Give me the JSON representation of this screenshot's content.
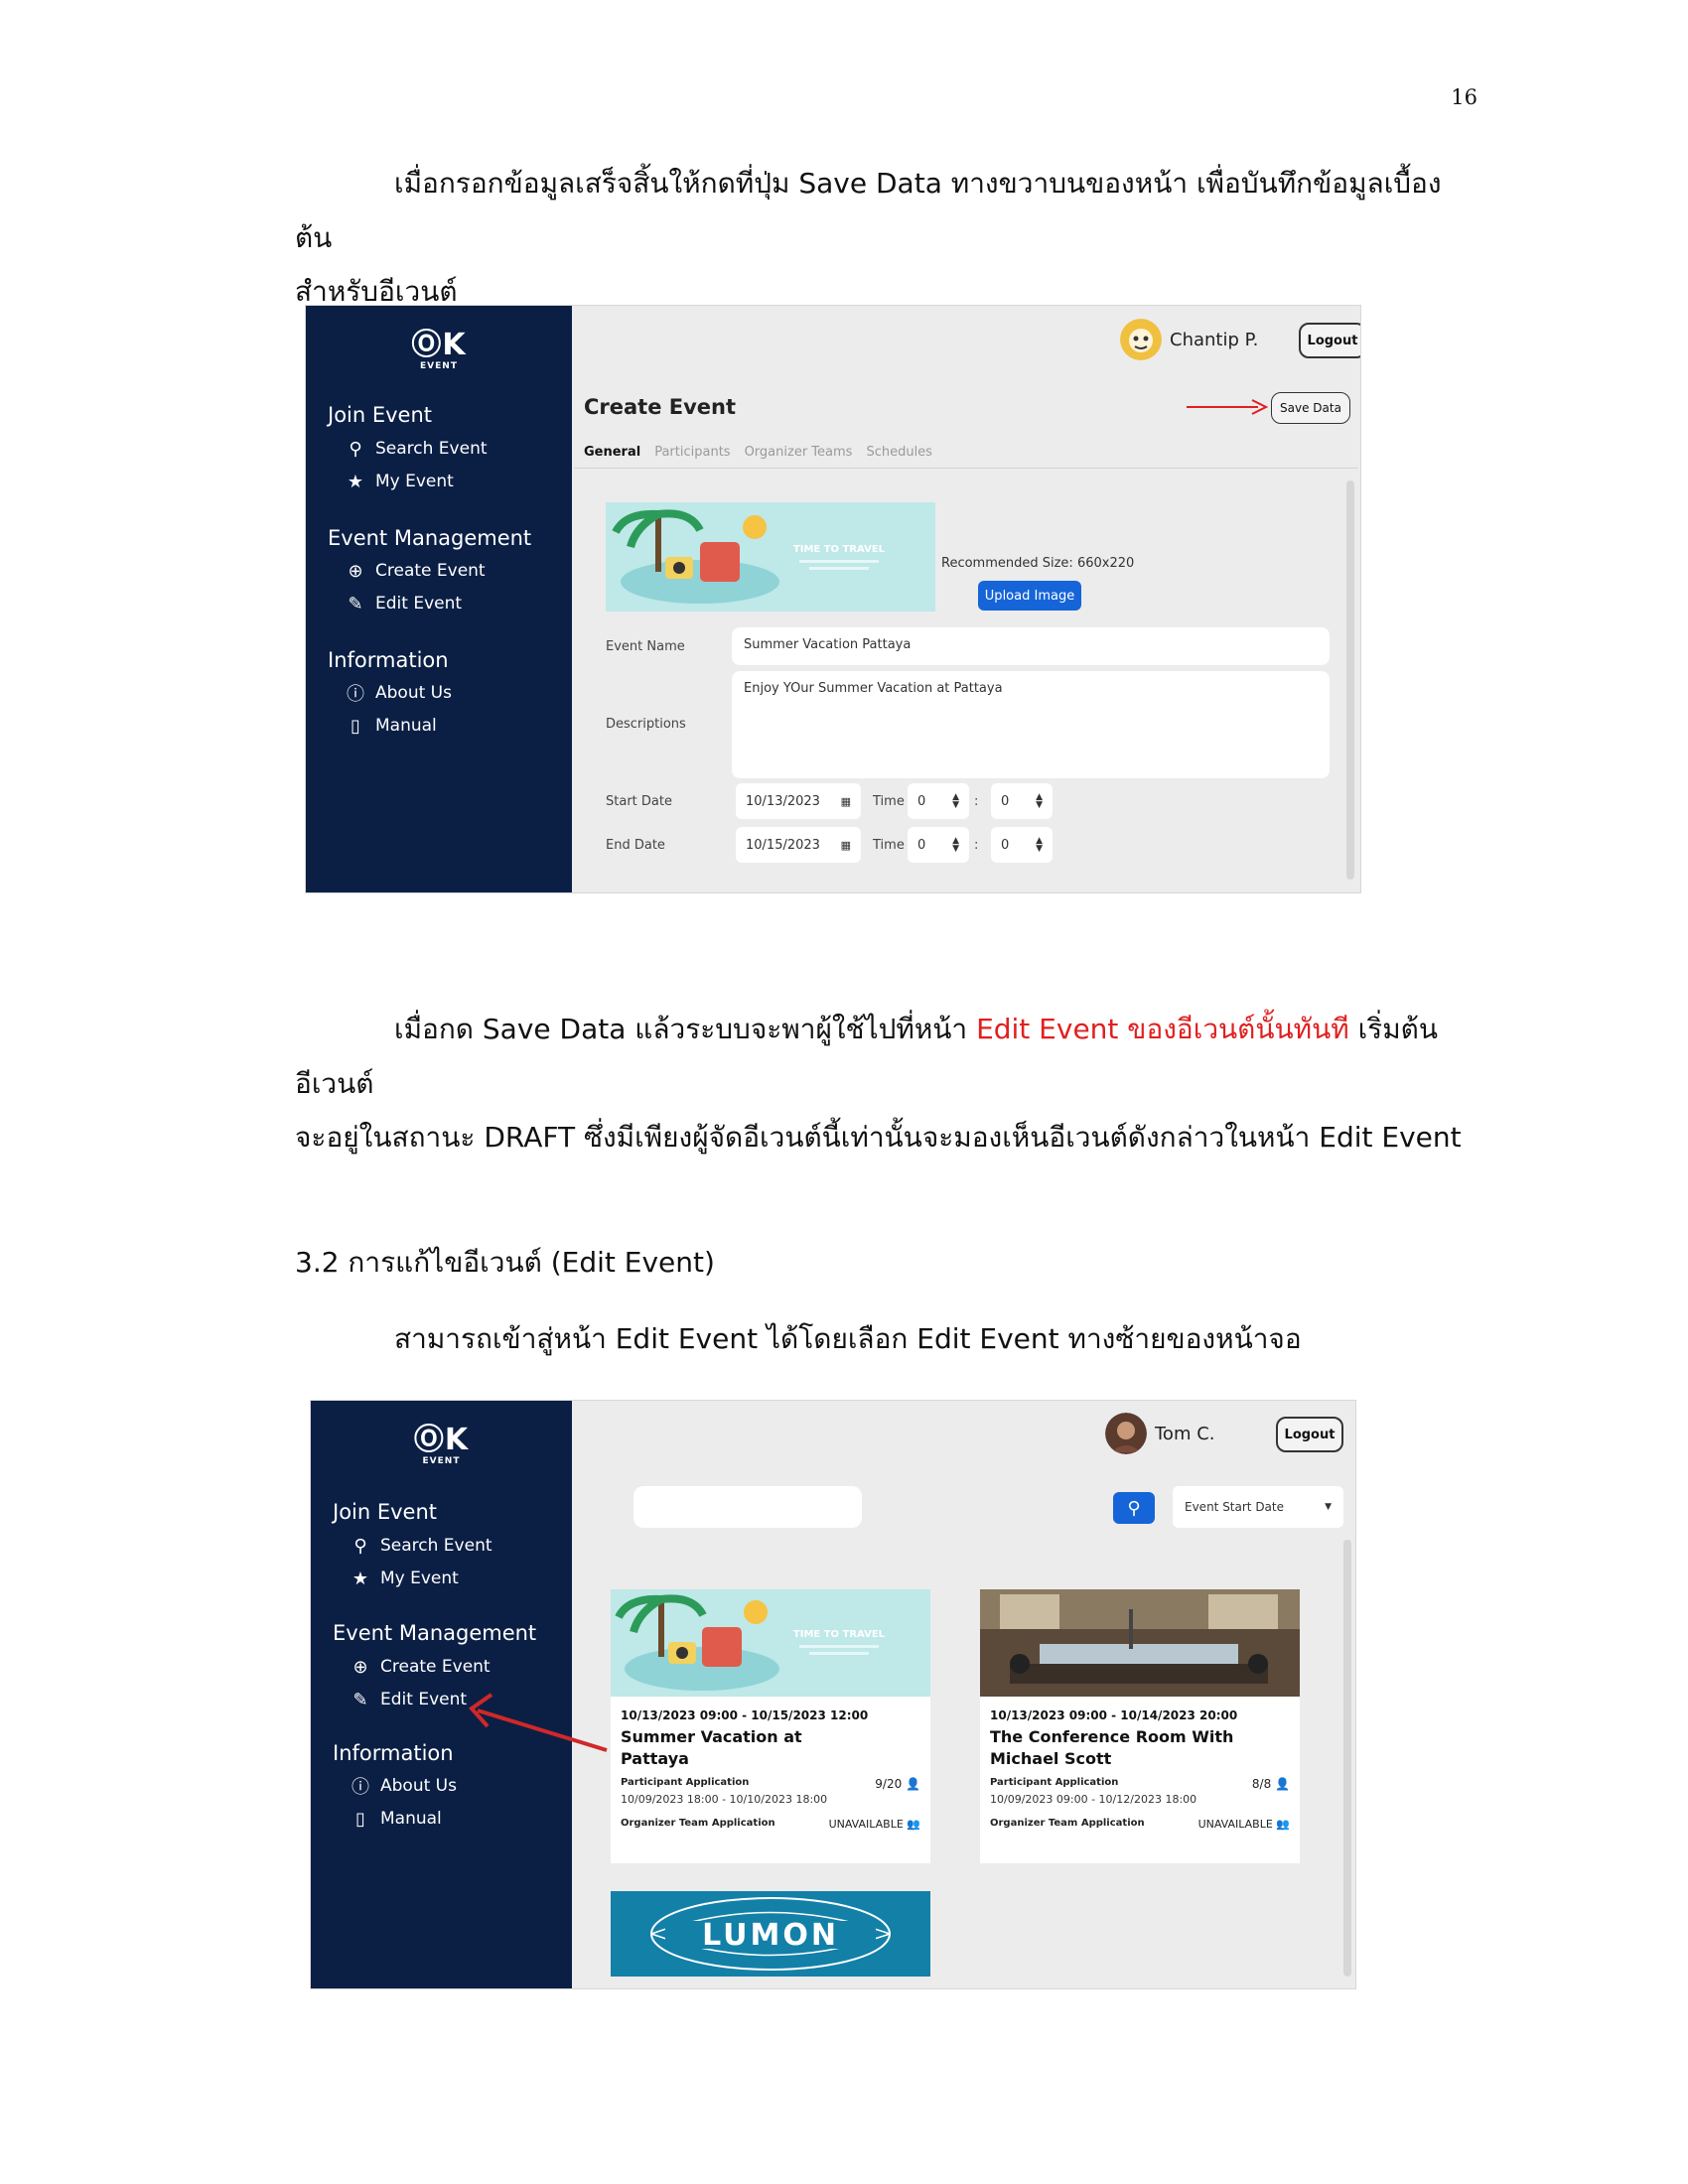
{
  "page_number": "16",
  "para1": {
    "line1": "เมื่อกรอกข้อมูลเสร็จสิ้นให้กดที่ปุ่ม Save Data ทางขวาบนของหน้า เพื่อบันทึกข้อมูลเบื้องต้น",
    "line2": "สำหรับอีเวนต์"
  },
  "para2": {
    "part1": "เมื่อกด Save Data แล้วระบบจะพาผู้ใช้ไปที่หน้า ",
    "part_red": "Edit Event ของอีเวนต์นั้นทันที",
    "part2": " เริ่มต้นอีเวนต์",
    "line2": "จะอยู่ในสถานะ DRAFT ซึ่งมีเพียงผู้จัดอีเวนต์นี้เท่านั้นจะมองเห็นอีเวนต์ดังกล่าวในหน้า Edit Event"
  },
  "section_heading": "3.2 การแก้ไขอีเวนต์ (Edit Event)",
  "para3": "สามารถเข้าสู่หน้า Edit Event ได้โดยเลือก Edit Event ทางซ้ายของหน้าจอ",
  "sidebar": {
    "logo": "ⓄK",
    "logo_sub": "EVENT",
    "join_title": "Join Event",
    "search_event": "Search Event",
    "my_event": "My Event",
    "mgmt_title": "Event Management",
    "create_event": "Create Event",
    "edit_event": "Edit Event",
    "info_title": "Information",
    "about_us": "About Us",
    "manual": "Manual"
  },
  "shot1": {
    "user_name": "Chantip P.",
    "logout": "Logout",
    "page_title": "Create Event",
    "save_data": "Save Data",
    "tabs": [
      "General",
      "Participants",
      "Organizer Teams",
      "Schedules"
    ],
    "banner_text": "TIME TO TRAVEL",
    "recommended": "Recommended Size: 660x220",
    "upload": "Upload Image",
    "event_name_label": "Event Name",
    "event_name_value": "Summer Vacation Pattaya",
    "descriptions_label": "Descriptions",
    "descriptions_value": "Enjoy YOur Summer Vacation at Pattaya",
    "start_label": "Start Date",
    "start_value": "10/13/2023",
    "end_label": "End Date",
    "end_value": "10/15/2023",
    "time_label": "Time",
    "hour": "0",
    "minute": "0",
    "colon": ":"
  },
  "shot2": {
    "user_name": "Tom C.",
    "logout": "Logout",
    "sort_select": "Event Start Date",
    "cards": [
      {
        "date": "10/13/2023 09:00 - 10/15/2023 12:00",
        "name_line1": "Summer Vacation at",
        "name_line2": "Pattaya",
        "participant_label": "Participant Application",
        "participant_count": "9/20",
        "participant_dates": "10/09/2023 18:00 - 10/10/2023 18:00",
        "organizer_label": "Organizer Team Application",
        "organizer_status": "UNAVAILABLE",
        "banner_text": "TIME TO TRAVEL"
      },
      {
        "date": "10/13/2023 09:00 - 10/14/2023 20:00",
        "name_line1": "The Conference Room With",
        "name_line2": "Michael Scott",
        "participant_label": "Participant Application",
        "participant_count": "8/8",
        "participant_dates": "10/09/2023 09:00 - 10/12/2023 18:00",
        "organizer_label": "Organizer Team Application",
        "organizer_status": "UNAVAILABLE"
      }
    ],
    "third_card_logo": "LUMON"
  },
  "colors": {
    "sidebar": "#0b1f45",
    "accent_blue": "#1565d8",
    "annotation_red": "#e02020"
  }
}
